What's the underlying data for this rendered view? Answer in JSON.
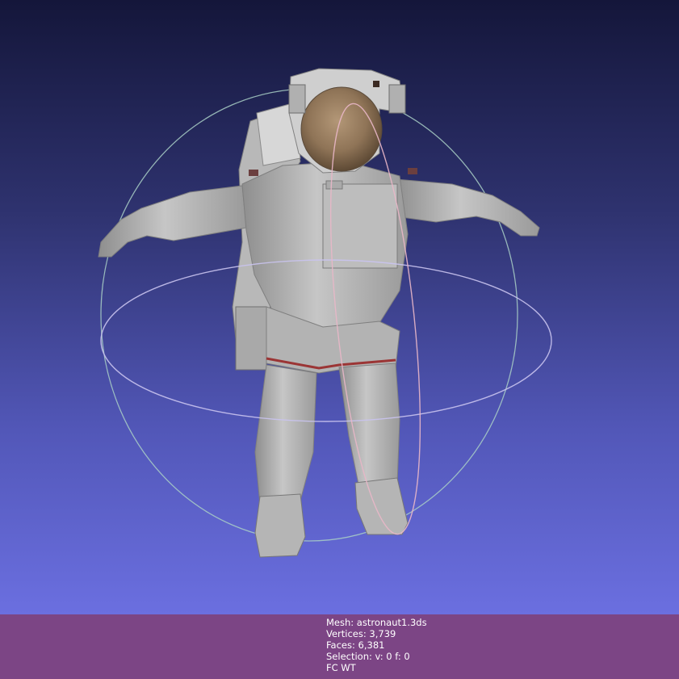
{
  "viewport": {
    "background_top": "#14163a",
    "background_bottom": "#6b6fe0",
    "model_name": "astronaut",
    "trackball_colors": {
      "horizontal": "#c9c3ee",
      "vertical": "#e9b7c8",
      "lateral": "#a9cfc6"
    }
  },
  "info": {
    "mesh": "Mesh: astronaut1.3ds",
    "vertices": "Vertices: 3,739",
    "faces": "Faces: 6,381",
    "selection": "Selection: v: 0 f: 0",
    "mode": "FC WT",
    "bar_color": "#7c4585"
  }
}
